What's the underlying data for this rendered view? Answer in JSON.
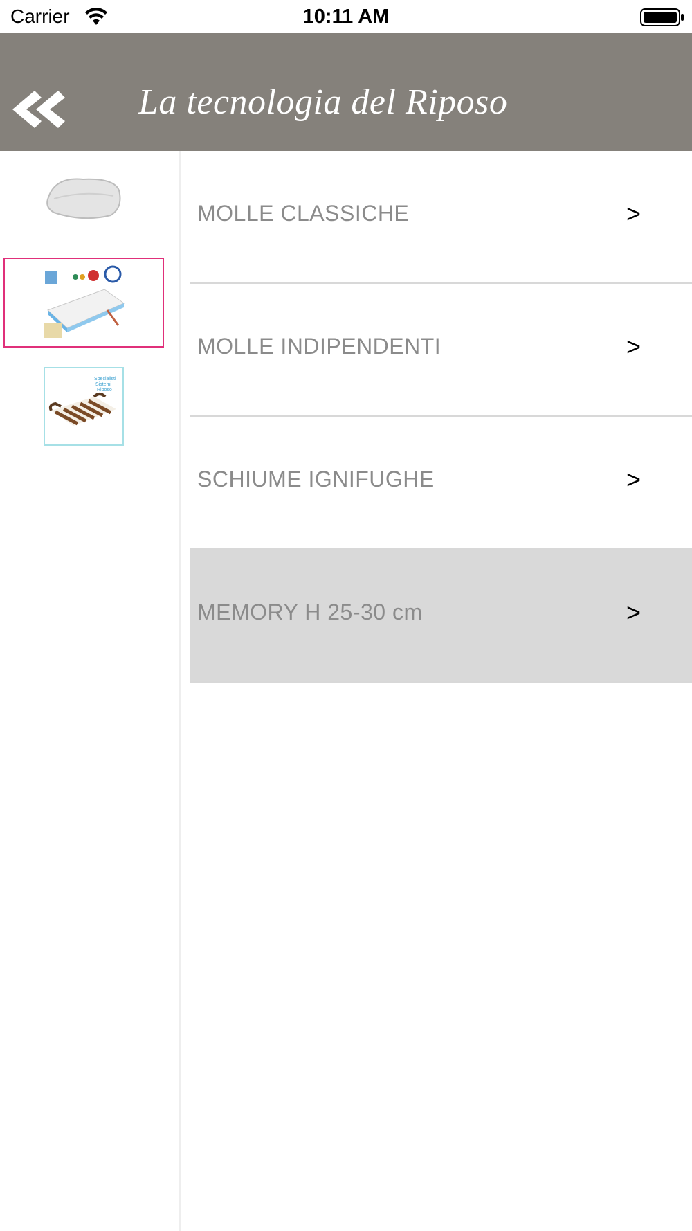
{
  "status_bar": {
    "carrier": "Carrier",
    "time": "10:11 AM",
    "icons": [
      "wifi-icon",
      "battery-icon"
    ]
  },
  "header": {
    "title": "La tecnologia del Riposo",
    "back_icon": "double-chevron-left-icon",
    "background_color": "#85817b"
  },
  "sidebar": {
    "items": [
      {
        "name": "pillow",
        "selected": false
      },
      {
        "name": "mattress",
        "selected": true
      },
      {
        "name": "bed-slats",
        "selected": false
      }
    ],
    "selected_border_color": "#e0307a"
  },
  "list": {
    "items": [
      {
        "label": "MOLLE CLASSICHE",
        "arrow": ">",
        "selected": false
      },
      {
        "label": "MOLLE INDIPENDENTI",
        "arrow": ">",
        "selected": false
      },
      {
        "label": "SCHIUME IGNIFUGHE",
        "arrow": ">",
        "selected": false
      },
      {
        "label": "MEMORY H 25-30 cm",
        "arrow": ">",
        "selected": true
      }
    ]
  }
}
